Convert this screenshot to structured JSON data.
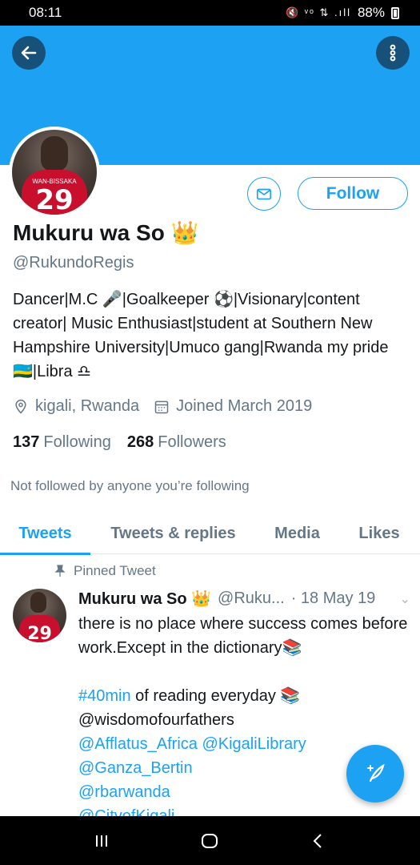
{
  "status_bar": {
    "time": "08:11",
    "icons": "🔇 ᵛᵒ ⇅ .ıll",
    "battery": "88%"
  },
  "header": {
    "back_icon": "arrow-left-icon",
    "more_icon": "more-vertical-icon",
    "banner_color": "#1da1f2"
  },
  "profile": {
    "display_name": "Mukuru wa So 👑",
    "handle": "@RukundoRegis",
    "bio": "Dancer|M.C 🎤|Goalkeeper ⚽|Visionary|content creator| Music Enthusiast|student at Southern New Hampshire University|Umuco gang|Rwanda my pride 🇷🇼|Libra ♎",
    "location": "kigali, Rwanda",
    "joined": "Joined March 2019",
    "following_count": "137",
    "following_label": "Following",
    "followers_count": "268",
    "followers_label": "Followers",
    "not_followed_text": "Not followed by anyone you’re following",
    "follow_label": "Follow",
    "avatar_jersey_number": "29",
    "avatar_jersey_name": "WAN-BISSAKA"
  },
  "tabs": [
    {
      "label": "Tweets",
      "active": true
    },
    {
      "label": "Tweets & replies",
      "active": false
    },
    {
      "label": "Media",
      "active": false
    },
    {
      "label": "Likes",
      "active": false
    }
  ],
  "tweet": {
    "pinned_label": "Pinned Tweet",
    "name": "Mukuru wa So 👑",
    "handle": "@Ruku...",
    "date": "· 18 May 19",
    "line1": "there is no place where success comes before work.Except in the dictionary📚",
    "hashtag": "#40min",
    "line2": " of reading everyday 📚",
    "mention1": "@wisdomofourfathers",
    "mention2": "@Afflatus_Africa",
    "mention3": "@KigaliLibrary",
    "mention4": "@Ganza_Bertin",
    "mention5": "@rbarwanda",
    "mention6": "@CityofKigali"
  },
  "accent_color": "#1da1f2"
}
